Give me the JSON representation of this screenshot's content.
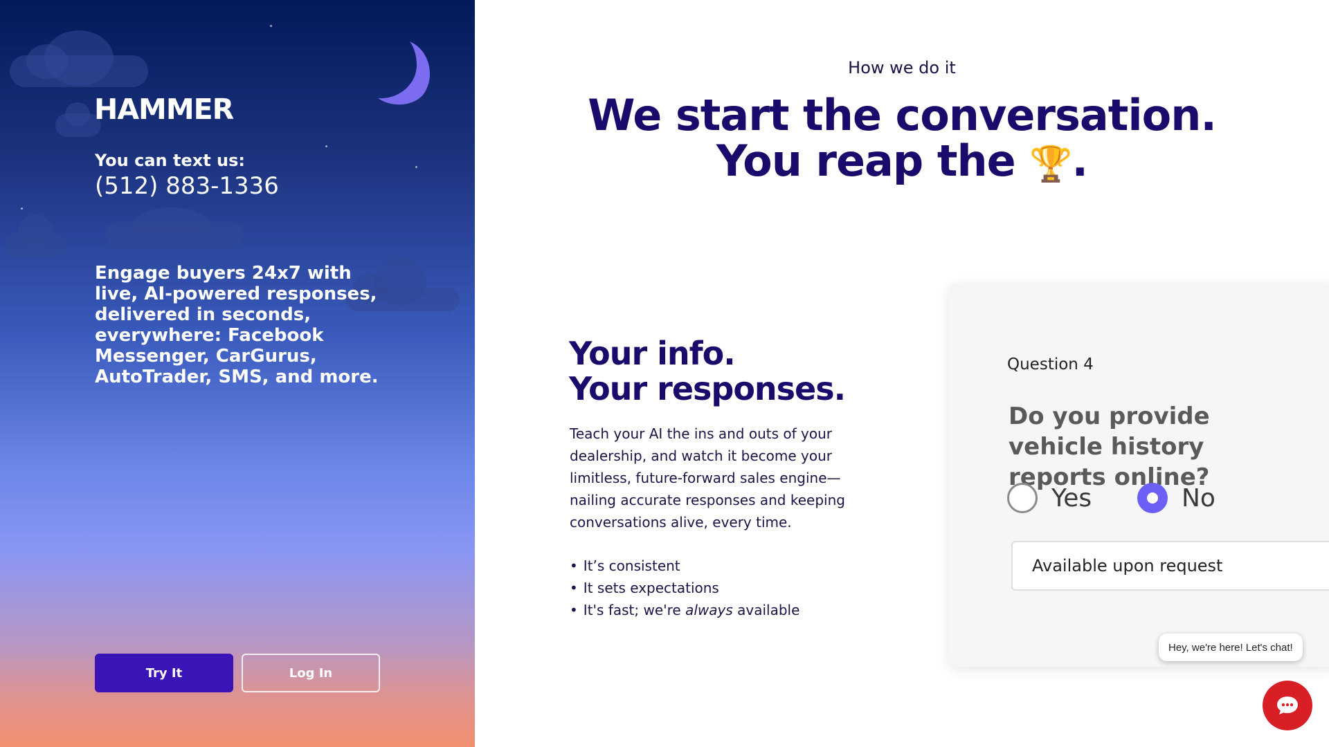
{
  "sidebar": {
    "logo": "HAMMER",
    "text_us_label": "You can text us:",
    "phone": "(512) 883-1336",
    "pitch": "Engage buyers 24x7 with live, AI-powered responses, delivered in seconds, everywhere: Facebook Messenger, CarGurus, AutoTrader, SMS, and more.",
    "try_button": "Try It",
    "login_button": "Log In",
    "icons": [
      "moon-icon",
      "cloud-icon"
    ]
  },
  "main": {
    "kicker": "How we do it",
    "headline_line1": "We start the conversation.",
    "headline_line2": "You reap the",
    "headline_emoji": "🏆",
    "headline_end": ".",
    "sub_title_line1": "Your info.",
    "sub_title_line2": "Your responses.",
    "body": "Teach your AI the ins and outs of your dealership, and watch it become your limitless, future-forward sales engine—nailing accurate responses and keeping conversations alive, every time.",
    "bullets": {
      "b1": "It’s consistent",
      "b2": "It sets expectations",
      "b3_start": "It's fast; we're ",
      "b3_em": "always",
      "b3_end": " available"
    }
  },
  "card": {
    "question_label": "Question 4",
    "question": "Do you provide vehicle history reports online?",
    "options": {
      "yes": "Yes",
      "no": "No"
    },
    "selected": "No",
    "answer_value": "Available upon request",
    "accent": "#6b5ff5"
  },
  "chat": {
    "bubble": "Hey, we're here! Let's chat!",
    "button_color": "#d91f26",
    "icon": "chat-icon"
  },
  "colors": {
    "brand_dark": "#1a0a6b",
    "try_button": "#3b14b8"
  }
}
